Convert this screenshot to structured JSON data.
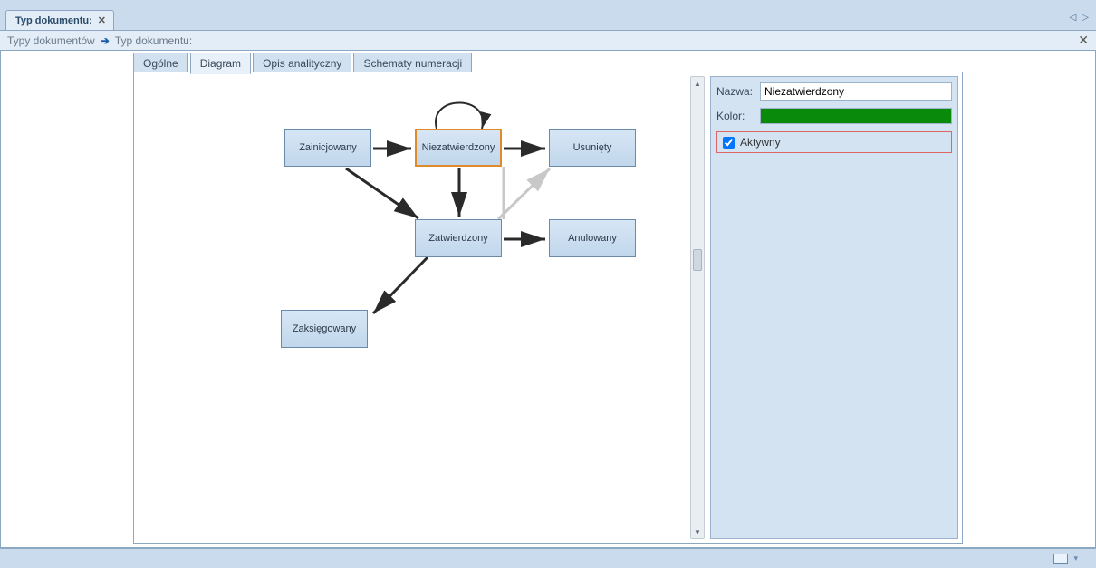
{
  "window_tab": {
    "title": "Typ dokumentu:"
  },
  "breadcrumb": {
    "root": "Typy dokumentów",
    "current": "Typ dokumentu:"
  },
  "inner_tabs": [
    {
      "label": "Ogólne"
    },
    {
      "label": "Diagram"
    },
    {
      "label": "Opis analityczny"
    },
    {
      "label": "Schematy numeracji"
    }
  ],
  "inner_tabs_active_index": 1,
  "nodes": {
    "zainicjowany": {
      "label": "Zainicjowany"
    },
    "niezatwierdzony": {
      "label": "Niezatwierdzony"
    },
    "usuniety": {
      "label": "Usunięty"
    },
    "zatwierdzony": {
      "label": "Zatwierdzony"
    },
    "anulowany": {
      "label": "Anulowany"
    },
    "zaksiegowany": {
      "label": "Zaksięgowany"
    }
  },
  "selected_node_key": "niezatwierdzony",
  "properties": {
    "name_label": "Nazwa:",
    "name_value": "Niezatwierdzony",
    "color_label": "Kolor:",
    "color_value": "#0a8a0a",
    "active_label": "Aktywny",
    "active_checked": true
  }
}
